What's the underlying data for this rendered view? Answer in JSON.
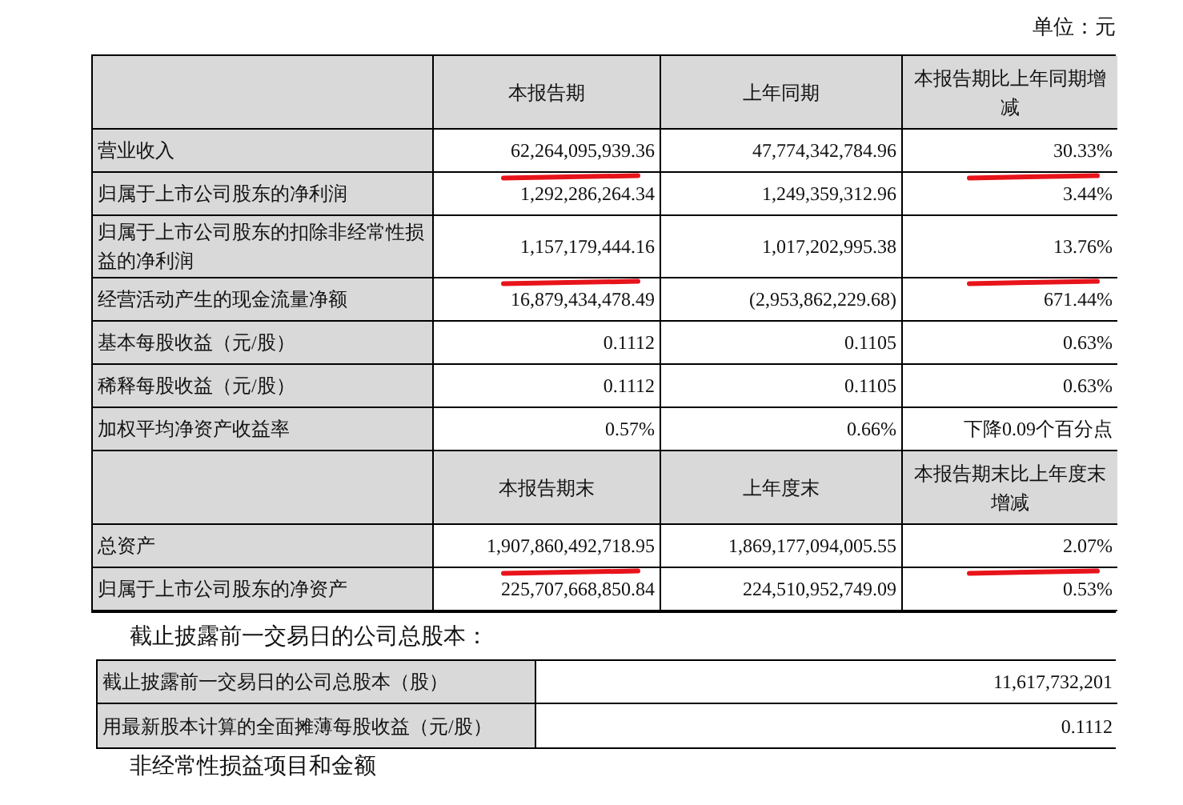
{
  "unit": "单位：元",
  "main_table": {
    "sections": [
      {
        "headers": [
          "本报告期",
          "上年同期",
          "本报告期比上年同期增减"
        ],
        "rows": [
          {
            "label": "营业收入",
            "values": [
              "62,264,095,939.36",
              "47,774,342,784.96",
              "30.33%"
            ],
            "annotated": [
              true,
              false,
              true
            ]
          },
          {
            "label": "归属于上市公司股东的净利润",
            "values": [
              "1,292,286,264.34",
              "1,249,359,312.96",
              "3.44%"
            ],
            "annotated": [
              false,
              false,
              false
            ]
          },
          {
            "label": "归属于上市公司股东的扣除非经常性损益的净利润",
            "values": [
              "1,157,179,444.16",
              "1,017,202,995.38",
              "13.76%"
            ],
            "annotated": [
              true,
              false,
              true
            ]
          },
          {
            "label": "经营活动产生的现金流量净额",
            "values": [
              "16,879,434,478.49",
              "(2,953,862,229.68)",
              "671.44%"
            ],
            "annotated": [
              false,
              false,
              false
            ]
          },
          {
            "label": "基本每股收益（元/股）",
            "values": [
              "0.1112",
              "0.1105",
              "0.63%"
            ],
            "annotated": [
              false,
              false,
              false
            ]
          },
          {
            "label": "稀释每股收益（元/股）",
            "values": [
              "0.1112",
              "0.1105",
              "0.63%"
            ],
            "annotated": [
              false,
              false,
              false
            ]
          },
          {
            "label": "加权平均净资产收益率",
            "values": [
              "0.57%",
              "0.66%",
              "下降0.09个百分点"
            ],
            "annotated": [
              false,
              false,
              false
            ]
          }
        ]
      },
      {
        "headers": [
          "本报告期末",
          "上年度末",
          "本报告期末比上年度末增减"
        ],
        "rows": [
          {
            "label": "总资产",
            "values": [
              "1,907,860,492,718.95",
              "1,869,177,094,005.55",
              "2.07%"
            ],
            "annotated": [
              true,
              false,
              true
            ]
          },
          {
            "label": "归属于上市公司股东的净资产",
            "values": [
              "225,707,668,850.84",
              "224,510,952,749.09",
              "0.53%"
            ],
            "annotated": [
              false,
              false,
              false
            ]
          }
        ]
      }
    ]
  },
  "share_heading": "截止披露前一交易日的公司总股本：",
  "share_table": [
    {
      "label": "截止披露前一交易日的公司总股本（股）",
      "value": "11,617,732,201"
    },
    {
      "label": "用最新股本计算的全面摊薄每股收益（元/股）",
      "value": "0.1112"
    }
  ],
  "next_heading": "非经常性损益项目和金额"
}
